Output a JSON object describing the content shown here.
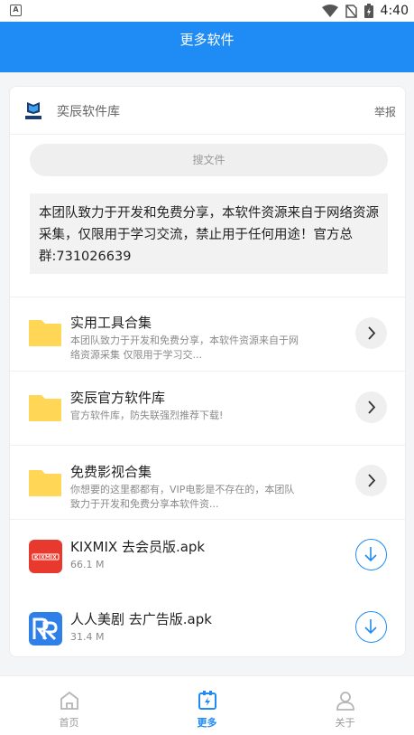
{
  "status_bar": {
    "time": "4:40",
    "notification_letter": "A"
  },
  "header": {
    "title": "更多软件"
  },
  "library": {
    "name": "奕辰软件库",
    "report_label": "举报",
    "logo_text": "奕辰库"
  },
  "search": {
    "placeholder": "搜文件"
  },
  "notice": {
    "text": "本团队致力于开发和免费分享，本软件资源来自于网络资源采集，仅限用于学习交流，禁止用于任何用途！官方总群:731026639"
  },
  "folders": [
    {
      "title": "实用工具合集",
      "desc": "本团队致力于开发和免费分享，本软件资源来自于网络资源采集 仅限用于学习交..."
    },
    {
      "title": "奕辰官方软件库",
      "desc": "官方软件库，防失联强烈推荐下载!"
    },
    {
      "title": "免费影视合集",
      "desc": "你想要的这里都都有，VIP电影是不存在的，本团队致力于开发和免费分享本软件资..."
    }
  ],
  "files": [
    {
      "title": "KIXMIX 去会员版.apk",
      "size": "66.1 M",
      "icon_text": "KIXMIX"
    },
    {
      "title": "人人美剧 去广告版.apk",
      "size": "31.4 M",
      "icon_text": "RR"
    }
  ],
  "nav": [
    {
      "label": "首页",
      "icon": "home-icon"
    },
    {
      "label": "更多",
      "icon": "more-icon"
    },
    {
      "label": "关于",
      "icon": "user-icon"
    }
  ],
  "colors": {
    "primary": "#1f8bf5",
    "folder": "#ffd656",
    "kixmix": "#e8392e",
    "rr": "#2f7fe8"
  }
}
